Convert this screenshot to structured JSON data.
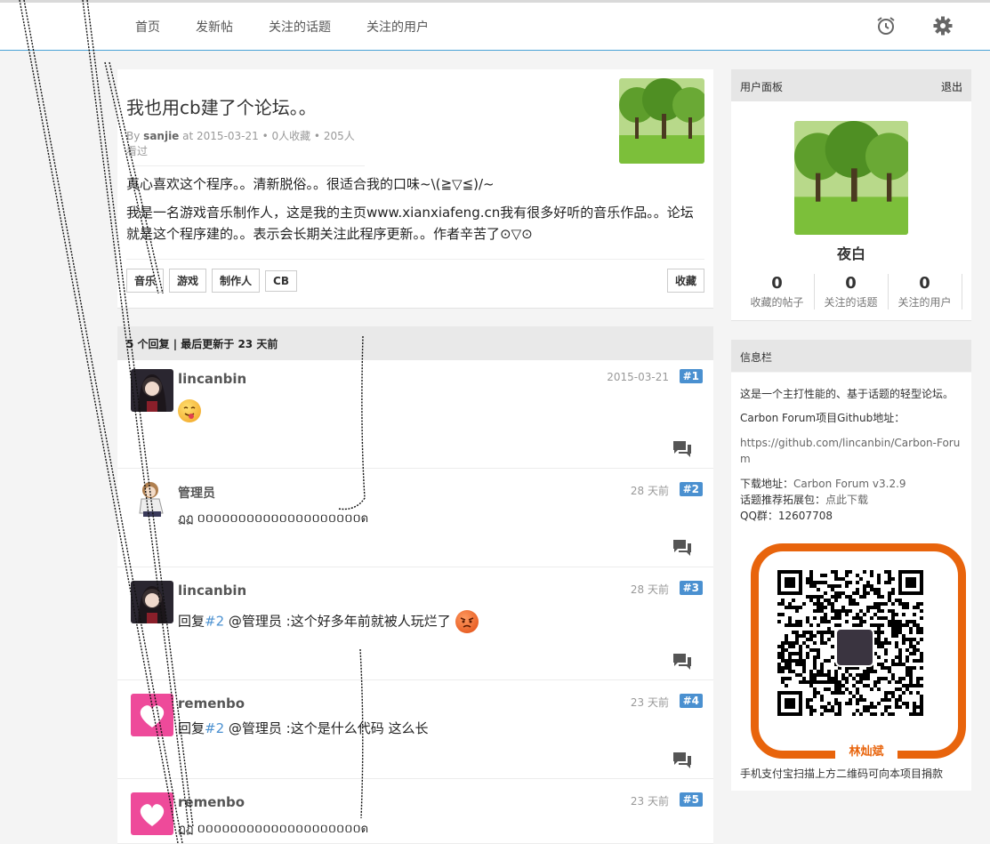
{
  "nav": {
    "items": [
      {
        "label": "首页"
      },
      {
        "label": "发新帖"
      },
      {
        "label": "关注的话题"
      },
      {
        "label": "关注的用户"
      }
    ],
    "alarm_icon": "alarm-clock-icon",
    "settings_icon": "gear-icon"
  },
  "topic": {
    "title": "我也用cb建了个论坛。。",
    "meta_prefix": "By",
    "author": "sanjie",
    "meta_rest": "at 2015-03-21 • 0人收藏 • 205人看过",
    "body_line1": "真心喜欢这个程序。。清新脱俗。。很适合我的口味~\\(≧▽≦)/~",
    "body_line2": "我是一名游戏音乐制作人，这是我的主页www.xianxiafeng.cn我有很多好听的音乐作品。。论坛就是这个程序建的。。表示会长期关注此程序更新。。作者辛苦了⊙▽⊙",
    "tags": [
      "音乐",
      "游戏",
      "制作人",
      "CB"
    ],
    "favorite_label": "收藏"
  },
  "replies_header": "5 个回复 | 最后更新于 23 天前",
  "replies": [
    {
      "user": "lincanbin",
      "time": "2015-03-21",
      "num": "#1",
      "text": ""
    },
    {
      "user": "管理员",
      "time": "28 天前",
      "num": "#2",
      "text": "ฏฏ ០០០០០០០០០០០០០០០០០០០០ด"
    },
    {
      "user": "lincanbin",
      "time": "28 天前",
      "num": "#3",
      "text_pre": "回复",
      "text_link": "#2",
      "text_post": " @管理员 :这个好多年前就被人玩烂了"
    },
    {
      "user": "remenbo",
      "time": "23 天前",
      "num": "#4",
      "text_pre": "回复",
      "text_link": "#2",
      "text_post": " @管理员 :这个是什么代码  这么长"
    },
    {
      "user": "remenbo",
      "time": "23 天前",
      "num": "#5",
      "text": "ฏฏ ០០០០០០០០០០០០០០០០០០០០ด"
    }
  ],
  "user_panel": {
    "title": "用户面板",
    "logout": "退出",
    "username": "夜白",
    "stats": [
      {
        "value": "0",
        "label": "收藏的帖子"
      },
      {
        "value": "0",
        "label": "关注的话题"
      },
      {
        "value": "0",
        "label": "关注的用户"
      }
    ]
  },
  "info_panel": {
    "title": "信息栏",
    "desc": "这是一个主打性能的、基于话题的轻型论坛。",
    "github_label": "Carbon Forum项目Github地址：",
    "github_url": "https://github.com/lincanbin/Carbon-Forum",
    "download_label": "下载地址：",
    "download_link": "Carbon Forum v3.2.9",
    "ext_label": "话题推荐拓展包：",
    "ext_link": "点此下载",
    "qq": "QQ群：12607708",
    "qr_name": "林灿斌",
    "donate": "手机支付宝扫描上方二维码可向本项目捐款"
  },
  "colors": {
    "accent": "#4a90d0",
    "qr_frame": "#e8640c",
    "nav_border": "#4aa3d6"
  }
}
